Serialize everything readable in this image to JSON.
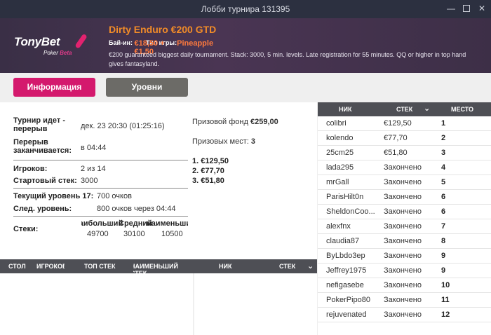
{
  "window": {
    "title": "Лобби турнира 131395"
  },
  "header": {
    "brand": "TonyBet",
    "brand_sub_a": "Poker",
    "brand_sub_b": "Beta",
    "tournament_name": "Dirty Enduro €200 GTD",
    "buyin_label": "Бай-ин:",
    "buyin_value": "€18,50 + €1,50",
    "game_type_label": "Тип игры:",
    "game_type_value": "Pineapple",
    "description": "€200 guaranteed biggest daily tournament. Stack: 3000, 5 min. levels. Late registration for 55 minutes. QQ or higher in top hand gives fantasyland."
  },
  "tabs": {
    "info": "Информация",
    "levels": "Уровни"
  },
  "info": {
    "status_label_1": "Турнир идет -",
    "status_label_2": "перерыв",
    "status_value": "дек. 23 20:30 (01:25:16)",
    "break_label_1": "Перерыв",
    "break_label_2": "заканчивается:",
    "break_value": "в 04:44",
    "players_label": "Игроков:",
    "players_value": "2 из 14",
    "start_stack_label": "Стартовый стек:",
    "start_stack_value": "3000",
    "current_level_label": "Текущий уровень 17:",
    "current_level_value": "700 очков",
    "next_level_label": "След. уровень:",
    "next_level_value": "800 очков через 04:44",
    "stacks_label": "Стеки:",
    "stack_headers": [
      "наибольший",
      "Средний",
      "наименьший"
    ],
    "stack_values": [
      "49700",
      "30100",
      "10500"
    ],
    "prize_pool_label": "Призовой фонд",
    "prize_pool_value": "€259,00",
    "prize_places_label": "Призовых мест:",
    "prize_places_value": "3",
    "prizes": [
      "1. €129,50",
      "2. €77,70",
      "3. €51,80"
    ]
  },
  "tables_header": {
    "table": "СТОЛ",
    "players": "ИГРОКОВ",
    "top_stack": "ТОП СТЕК",
    "min_stack": "НАИМЕНЬШИЙ СТЕК",
    "nick": "НИК",
    "stack": "СТЕК"
  },
  "players_header": {
    "nick": "НИК",
    "stack": "СТЕК",
    "place": "МЕСТО"
  },
  "players": [
    {
      "nick": "colibri",
      "stack": "€129,50",
      "place": "1"
    },
    {
      "nick": "kolendo",
      "stack": "€77,70",
      "place": "2"
    },
    {
      "nick": "25cm25",
      "stack": "€51,80",
      "place": "3"
    },
    {
      "nick": "lada295",
      "stack": "Закончено",
      "place": "4"
    },
    {
      "nick": "mrGall",
      "stack": "Закончено",
      "place": "5"
    },
    {
      "nick": "ParisHilt0n",
      "stack": "Закончено",
      "place": "6"
    },
    {
      "nick": "SheldonCoo...",
      "stack": "Закончено",
      "place": "6"
    },
    {
      "nick": "alexfnx",
      "stack": "Закончено",
      "place": "7"
    },
    {
      "nick": "claudia87",
      "stack": "Закончено",
      "place": "8"
    },
    {
      "nick": "ByLbdo3ep",
      "stack": "Закончено",
      "place": "9"
    },
    {
      "nick": "Jeffrey1975",
      "stack": "Закончено",
      "place": "9"
    },
    {
      "nick": "nefigasebe",
      "stack": "Закончено",
      "place": "10"
    },
    {
      "nick": "PokerPipo80",
      "stack": "Закончено",
      "place": "11"
    },
    {
      "nick": "rejuvenated",
      "stack": "Закончено",
      "place": "12"
    }
  ]
}
